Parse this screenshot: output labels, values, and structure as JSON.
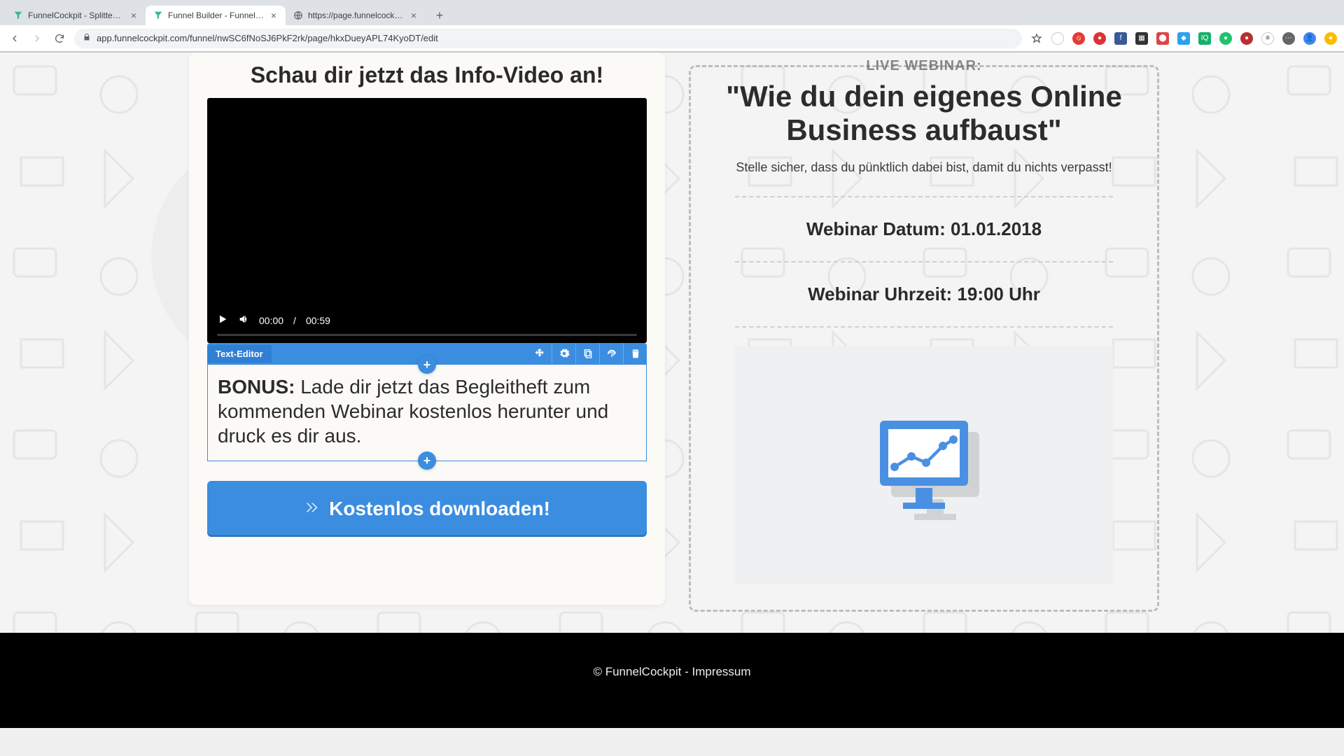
{
  "browser": {
    "tabs": [
      {
        "title": "FunnelCockpit - Splittests, Ma",
        "active": false,
        "favicon": "funnel"
      },
      {
        "title": "Funnel Builder - FunnelCockpit",
        "active": true,
        "favicon": "funnel"
      },
      {
        "title": "https://page.funnelcockpit.co",
        "active": false,
        "favicon": "globe"
      }
    ],
    "url": "app.funnelcockpit.com/funnel/nwSC6fNoSJ6PkF2rk/page/hkxDueyAPL74KyoDT/edit"
  },
  "editor": {
    "heading": "Schau dir jetzt das Info-Video an!",
    "video": {
      "current_time": "00:00",
      "separator": "/",
      "duration": "00:59"
    },
    "selected_element_label": "Text-Editor",
    "bonus_label": "BONUS:",
    "bonus_text": " Lade dir jetzt das Begleitheft zum kommenden Webinar kostenlos herunter und druck es dir aus.",
    "cta_label": "Kostenlos downloaden!"
  },
  "webinar": {
    "eyebrow": "LIVE WEBINAR:",
    "headline": "\"Wie du dein eigenes Online Business aufbaust\"",
    "subline": "Stelle sicher, dass du pünktlich dabei bist, damit du nichts verpasst!",
    "date_label": "Webinar Datum: 01.01.2018",
    "time_label": "Webinar Uhrzeit: 19:00 Uhr"
  },
  "footer": {
    "copyright": "© FunnelCockpit - Impressum"
  },
  "colors": {
    "primary": "#3b8de0"
  }
}
